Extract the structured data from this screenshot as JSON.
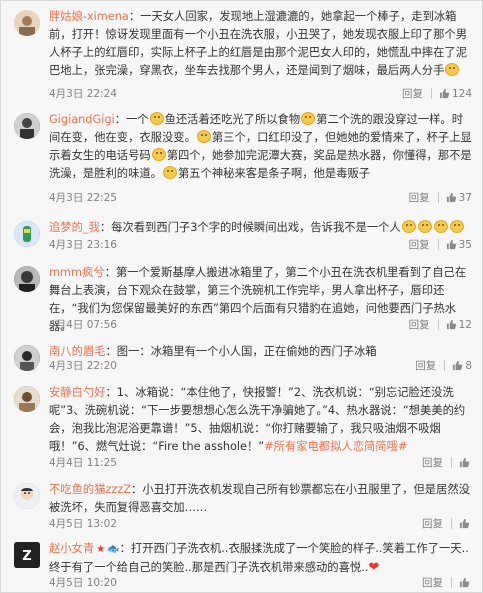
{
  "reply_label": "回复",
  "comments": [
    {
      "username": "胖姑娘-ximena",
      "segments": [
        "：一天女人回家，发现地上湿漉漉的，她拿起一个棒子，走到冰箱前，打开！惊讶发现里面有一个小丑在洗衣服，小丑哭了，她发现衣服上印了那个男人杯子上的红唇印，实际上杯子上的红唇是由那个泥巴女人印的，她慌乱中摔在了泥巴地上，张完澡，穿黑衣，坐车去找那个男人，还是闻到了烟味，最后两人分手"
      ],
      "time": "4月3日 22:24",
      "likes": "124",
      "avatar_color": "#d9b99b"
    },
    {
      "username": "GigiandGigi",
      "segments": [
        "：一个",
        "鱼还活着还吃光了所以食物",
        "第二个洗的跟没穿过一样。时间在变，他在变，衣服没变。",
        "第三个，口红印没了，但她她的爱情来了，杯子上显示着女生的电话号码",
        "第四个，她参加完泥潭大赛，奖品是热水器，你懂得，那不是洗澡，是胜利的味道。",
        "第五个神秘来客是条子啊，他是毒贩子"
      ],
      "time": "4月3日 22:25",
      "likes": "37",
      "avatar_color": "#6c6c6c"
    },
    {
      "username": "追梦的_我",
      "segments": [
        "：每次看到西门子3个字的时候瞬间出戏，告诉我不是一个人"
      ],
      "time": "4月3日 23:16",
      "likes": "35",
      "avatar_color": "#6a8fc0"
    },
    {
      "username": "mmm疯兮",
      "segments": [
        "：第一个爱斯基摩人搬进冰箱里了，第二个小丑在洗衣机里看到了自己在舞台上表演，台下观众在鼓掌，第三个洗碗机工作完毕，男人拿出杯子，唇印还在，“我们为您保留最美好的东西”第四个后面有只猎豹在追她，问他要西门子热水器。"
      ],
      "time": "4月4日 07:56",
      "likes": "12",
      "avatar_color": "#5c5c5c"
    },
    {
      "username": "南八的眉毛",
      "segments": [
        "：图一：冰箱里有一个小人国，正在偷她的西门子冰箱"
      ],
      "time": "4月3日 22:20",
      "likes": "8",
      "avatar_color": "#4a4a4a"
    },
    {
      "username": "安静白勺好",
      "segments": [
        "：1、冰箱说：“本住他了，快报警！”2、洗衣机说：“别忘记脸还没洗呢”3、洗碗机说：“下一步要想想心怎么洗干净骗她了。”4、热水器说：“想美美的约会，泡我比泡泥浴更靠谱！”5、抽烟机说：“你打赌要输了，我只吸油烟不吸烟哦！”6、燃气灶说：“Fire the asshole！”",
        "#所有家电都拟人恋简简哦#"
      ],
      "time": "4月4日 11:25",
      "likes": "",
      "avatar_color": "#8a6f4d"
    },
    {
      "username": "不吃鱼的猫zzzZ",
      "segments": [
        "：小丑打开洗衣机发现自己所有钞票都忘在小丑服里了，但是居然没被洗坏，失而复得恶喜交加……"
      ],
      "time": "4月5日 13:02",
      "likes": "",
      "avatar_color": "#9aa7b4"
    },
    {
      "username": "赵小女青",
      "badges": [
        "★",
        "🐟"
      ],
      "segments": [
        "：打开西门子洗衣机..衣服揉洗成了一个笑脸的样子..笑着工作了一天..终于有了一个给自己的笑脸..那是西门子洗衣机带来感动的喜悦.."
      ],
      "time": "4月5日 10:20",
      "likes": "",
      "avatar_color": "#2b2b2b"
    }
  ]
}
